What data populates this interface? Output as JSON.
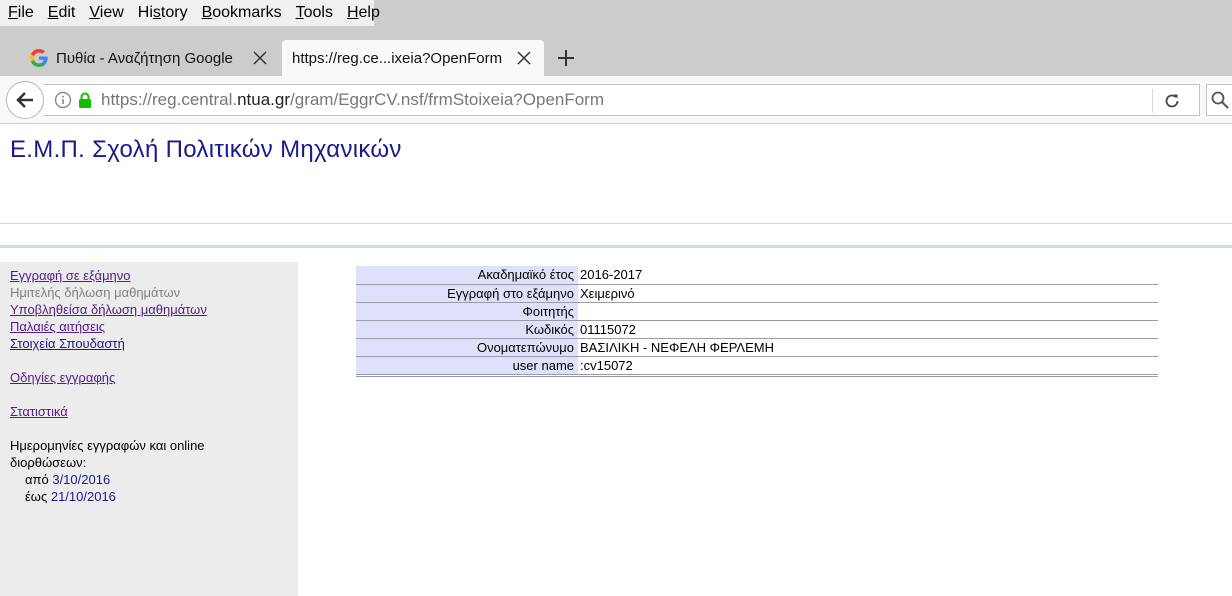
{
  "menubar": {
    "items": [
      {
        "label": "File"
      },
      {
        "label": "Edit"
      },
      {
        "label": "View"
      },
      {
        "label": "History"
      },
      {
        "label": "Bookmarks"
      },
      {
        "label": "Tools"
      },
      {
        "label": "Help"
      }
    ]
  },
  "tabs": [
    {
      "title": "Πυθία - Αναζήτηση Google",
      "icon": "google-g-icon",
      "active": false
    },
    {
      "title": "https://reg.ce...ixeia?OpenForm",
      "icon": "",
      "active": true
    }
  ],
  "address": {
    "url_prefix": "https://reg.central.",
    "url_domain": "ntua.gr",
    "url_suffix": "/gram/EggrCV.nsf/frmStoixeia?OpenForm"
  },
  "page": {
    "title": "Ε.Μ.Π. Σχολή Πολιτικών Μηχανικών"
  },
  "sidebar": {
    "links": [
      {
        "label": "Εγγραφή σε εξάμηνο",
        "state": "visited"
      },
      {
        "label": "Ημιτελής δήλωση μαθημάτων",
        "state": "disabled"
      },
      {
        "label": "Υποβληθείσα δήλωση μαθημάτων",
        "state": "visited"
      },
      {
        "label": "Παλαιές αιτήσεις",
        "state": "visited"
      },
      {
        "label": "Στοιχεία Σπουδαστή",
        "state": "active"
      }
    ],
    "instructions_link": "Οδηγίες εγγραφής",
    "statistics_link": "Στατιστικά",
    "dates_heading_1": "Ημερομηνίες εγγραφών και online",
    "dates_heading_2": "διορθώσεων:",
    "from_label": "από",
    "from_date": "3/10/2016",
    "to_label": "έως",
    "to_date": "21/10/2016"
  },
  "student_info": {
    "rows": [
      {
        "label": "Ακαδημαϊκό έτος",
        "value": "2016-2017"
      },
      {
        "label": "Εγγραφή στο εξάμηνο",
        "value": "Χειμερινό"
      },
      {
        "label": "Φοιτητής",
        "value": ""
      },
      {
        "label": "Κωδικός",
        "value": "01115072"
      },
      {
        "label": "Ονοματεπώνυμο",
        "value": "ΒΑΣΙΛΙΚΗ - ΝΕΦΕΛΗ ΦΕΡΛΕΜΗ"
      },
      {
        "label": "user name",
        "value": ":cv15072"
      }
    ]
  },
  "colors": {
    "title_blue": "#1a1a8c",
    "visited_link": "#551a8b",
    "label_bg": "#dfe0fa",
    "sidebar_bg": "#ececec",
    "lock_green": "#12bc00"
  }
}
